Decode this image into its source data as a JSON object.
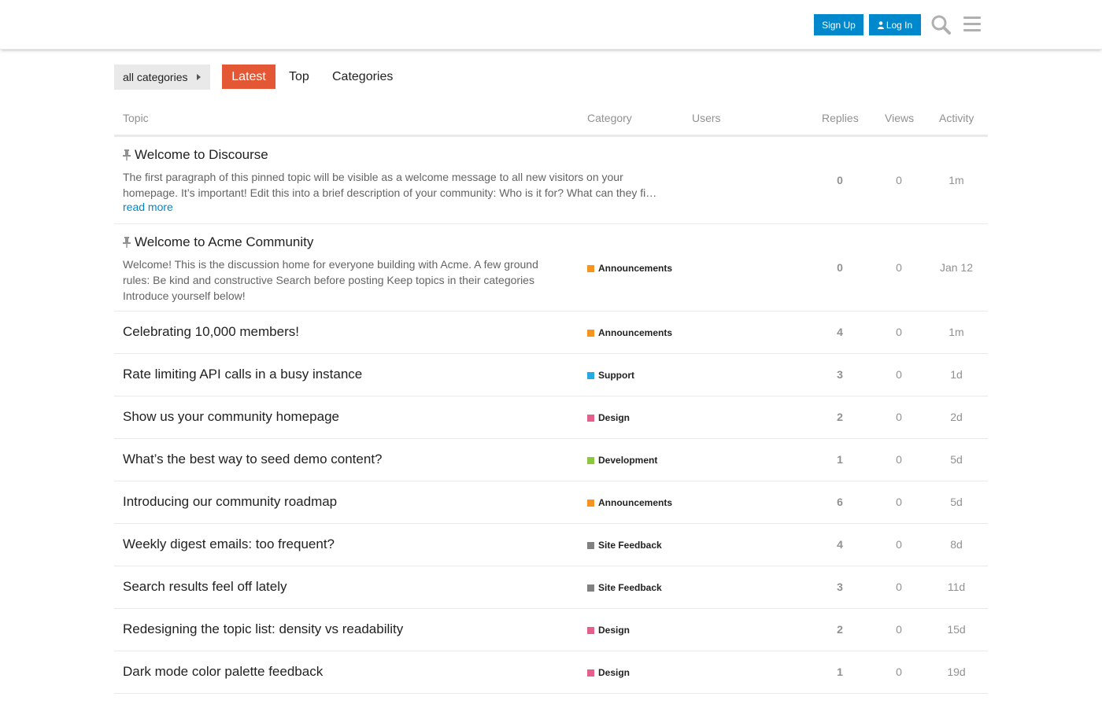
{
  "header": {
    "signup_label": "Sign Up",
    "login_label": "Log In",
    "search_icon": "search-icon",
    "menu_icon": "hamburger-menu-icon"
  },
  "nav": {
    "category_dropdown": "all categories",
    "tabs": [
      {
        "label": "Latest",
        "active": true
      },
      {
        "label": "Top",
        "active": false
      },
      {
        "label": "Categories",
        "active": false
      }
    ]
  },
  "colors": {
    "accent": "#e45735",
    "link": "#0088cc",
    "Announcements": "#F7941D",
    "Support": "#25AAE2",
    "Design": "#E45F8C",
    "Development": "#8DC63F",
    "Site Feedback": "#808281"
  },
  "table": {
    "columns": {
      "topic": "Topic",
      "category": "Category",
      "users": "Users",
      "replies": "Replies",
      "views": "Views",
      "activity": "Activity"
    },
    "topics": [
      {
        "title": "Welcome to Discourse",
        "pinned": true,
        "excerpt": "The first paragraph of this pinned topic will be visible as a welcome message to all new visitors on your homepage. It’s important! Edit this into a brief description of your community: Who is it for? What can they fi…",
        "read_more": "read more",
        "category": "",
        "replies": "0",
        "views": "0",
        "activity": "1m"
      },
      {
        "title": "Welcome to Acme Community",
        "pinned": true,
        "excerpt": "Welcome! This is the discussion home for everyone building with Acme. A few ground rules: Be kind and constructive Search before posting Keep topics in their categories Introduce yourself below!",
        "category": "Announcements",
        "replies": "0",
        "views": "0",
        "activity": "Jan 12"
      },
      {
        "title": "Celebrating 10,000 members!",
        "category": "Announcements",
        "replies": "4",
        "views": "0",
        "activity": "1m"
      },
      {
        "title": "Rate limiting API calls in a busy instance",
        "category": "Support",
        "replies": "3",
        "views": "0",
        "activity": "1d"
      },
      {
        "title": "Show us your community homepage",
        "category": "Design",
        "replies": "2",
        "views": "0",
        "activity": "2d"
      },
      {
        "title": "What’s the best way to seed demo content?",
        "category": "Development",
        "replies": "1",
        "views": "0",
        "activity": "5d"
      },
      {
        "title": "Introducing our community roadmap",
        "category": "Announcements",
        "replies": "6",
        "views": "0",
        "activity": "5d"
      },
      {
        "title": "Weekly digest emails: too frequent?",
        "category": "Site Feedback",
        "replies": "4",
        "views": "0",
        "activity": "8d"
      },
      {
        "title": "Search results feel off lately",
        "category": "Site Feedback",
        "replies": "3",
        "views": "0",
        "activity": "11d"
      },
      {
        "title": "Redesigning the topic list: density vs readability",
        "category": "Design",
        "replies": "2",
        "views": "0",
        "activity": "15d"
      },
      {
        "title": "Dark mode color palette feedback",
        "category": "Design",
        "replies": "1",
        "views": "0",
        "activity": "19d"
      }
    ]
  }
}
